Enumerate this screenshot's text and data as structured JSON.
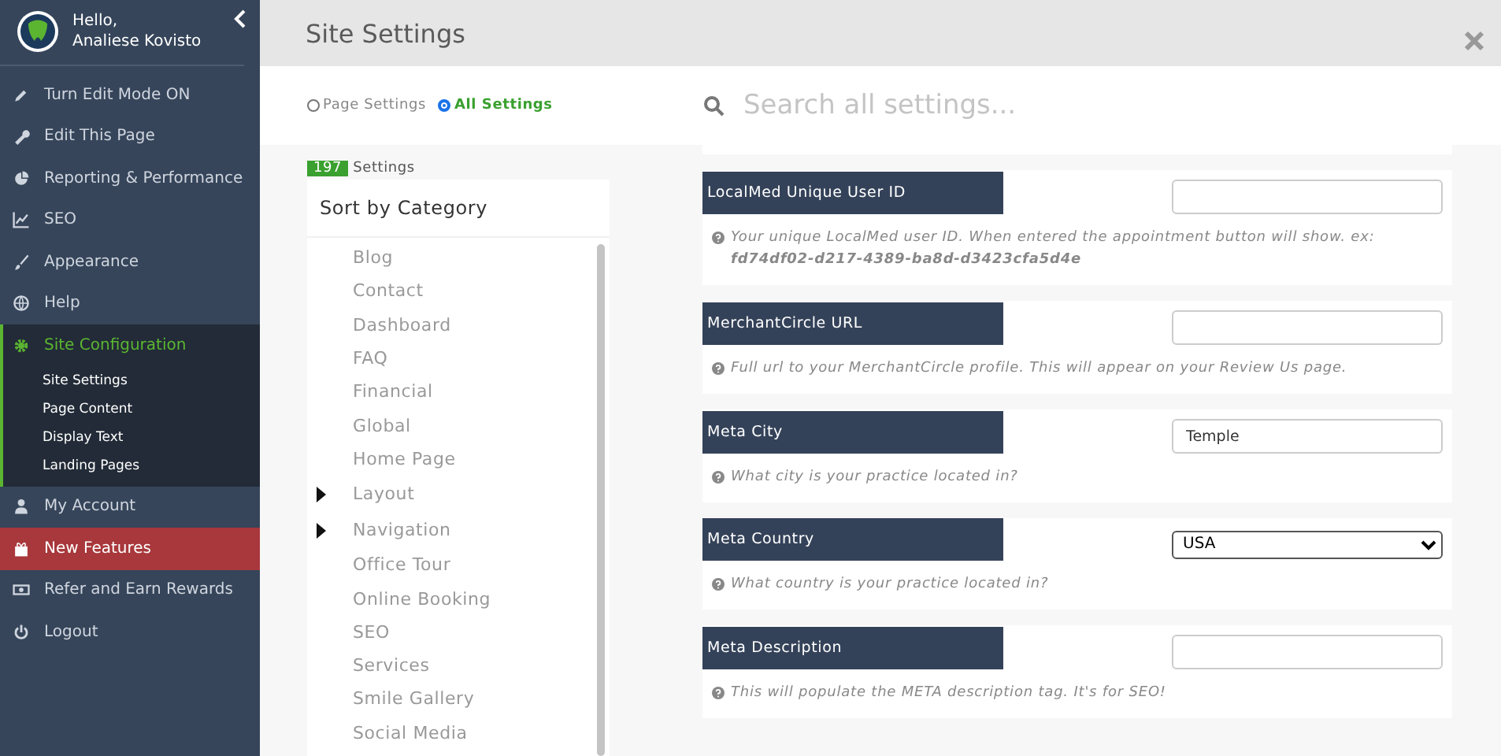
{
  "sidebar": {
    "greeting": "Hello,",
    "user_name": "Analiese Kovisto",
    "items": [
      {
        "label": "Turn Edit Mode ON",
        "selected": false,
        "highlighted": false
      },
      {
        "label": "Edit This Page",
        "selected": false,
        "highlighted": false
      },
      {
        "label": "Reporting & Performance",
        "selected": false,
        "highlighted": false
      },
      {
        "label": "SEO",
        "selected": false,
        "highlighted": false
      },
      {
        "label": "Appearance",
        "selected": false,
        "highlighted": false
      },
      {
        "label": "Help",
        "selected": false,
        "highlighted": false
      },
      {
        "label": "Site Configuration",
        "selected": true,
        "highlighted": false,
        "children": [
          {
            "label": "Site Settings"
          },
          {
            "label": "Page Content"
          },
          {
            "label": "Display Text"
          },
          {
            "label": "Landing Pages"
          }
        ]
      },
      {
        "label": "My Account",
        "selected": false,
        "highlighted": false
      },
      {
        "label": "New Features",
        "selected": false,
        "highlighted": true
      },
      {
        "label": "Refer and Earn Rewards",
        "selected": false,
        "highlighted": false
      },
      {
        "label": "Logout",
        "selected": false,
        "highlighted": false
      }
    ]
  },
  "window": {
    "title": "Site Settings"
  },
  "scope_options": [
    {
      "label": "Page Settings",
      "selected": false
    },
    {
      "label": "All Settings",
      "selected": true
    }
  ],
  "search": {
    "placeholder": "Search all settings..."
  },
  "settings_count": {
    "count": "197",
    "label": "Settings"
  },
  "categories": {
    "title": "Sort by Category",
    "items": [
      {
        "label": "Blog",
        "kind": "leaf"
      },
      {
        "label": "Contact",
        "kind": "leaf"
      },
      {
        "label": "Dashboard",
        "kind": "leaf"
      },
      {
        "label": "FAQ",
        "kind": "leaf"
      },
      {
        "label": "Financial",
        "kind": "leaf"
      },
      {
        "label": "Global",
        "kind": "leaf"
      },
      {
        "label": "Home Page",
        "kind": "leaf"
      },
      {
        "label": "Layout",
        "kind": "group"
      },
      {
        "label": "Navigation",
        "kind": "group"
      },
      {
        "label": "Office Tour",
        "kind": "leaf"
      },
      {
        "label": "Online Booking",
        "kind": "leaf"
      },
      {
        "label": "SEO",
        "kind": "leaf"
      },
      {
        "label": "Services",
        "kind": "leaf"
      },
      {
        "label": "Smile Gallery",
        "kind": "leaf"
      },
      {
        "label": "Social Media",
        "kind": "leaf"
      }
    ]
  },
  "settings": [
    {
      "label": "LocalMed Unique User ID",
      "kind": "text",
      "help": "Your unique LocalMed user ID. When entered the appointment button will show. ex: **fd74df02-d217-4389-ba8d-d3423cfa5d4e**"
    },
    {
      "label": "MerchantCircle URL",
      "kind": "text",
      "help": "Full url to your MerchantCircle profile. This will appear on your Review Us page."
    },
    {
      "label": "Meta City",
      "kind": "text",
      "value": "Temple",
      "help": "What city is your practice located in?"
    },
    {
      "label": "Meta Country",
      "kind": "select",
      "value": "USA",
      "help": "What country is your practice located in?"
    },
    {
      "label": "Meta Description",
      "kind": "text",
      "help": "This will populate the META description tag. It's for SEO!"
    }
  ]
}
